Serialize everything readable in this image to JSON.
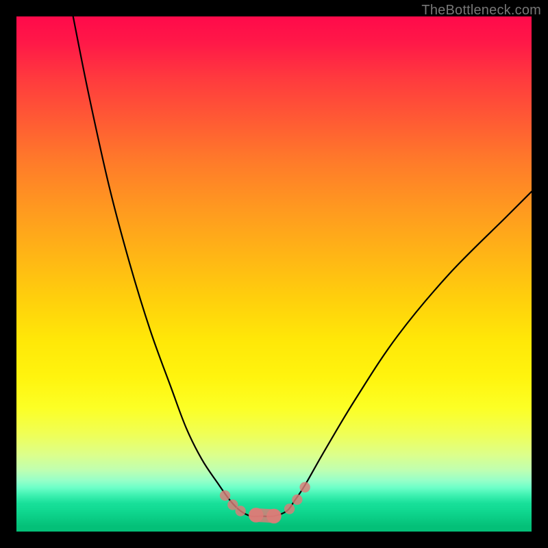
{
  "brand": {
    "watermark": "TheBottleneck.com"
  },
  "colors": {
    "background": "#000000",
    "curve": "#000000",
    "marker": "#de7b78",
    "gradient_top": "#ff0a4a",
    "gradient_bottom": "#04c078"
  },
  "chart_data": {
    "type": "line",
    "title": "",
    "xlabel": "",
    "ylabel": "",
    "xlim": [
      0,
      100
    ],
    "ylim": [
      0,
      100
    ],
    "grid": false,
    "legend": false,
    "note": "V-shaped bottleneck curve over a vertical red→orange→yellow→green gradient. No axis ticks or labels are rendered. Percent values are read off relative position inside the 752×752 plot area.",
    "series": [
      {
        "name": "bottleneck-curve",
        "x": [
          11,
          14,
          18,
          22,
          26,
          30,
          33,
          36,
          39,
          41.5,
          43.5,
          45.5,
          47.5,
          50,
          52.5,
          54,
          56,
          60,
          66,
          74,
          84,
          95,
          100
        ],
        "y": [
          100,
          85,
          67,
          52,
          39,
          28,
          20,
          14,
          9.5,
          6,
          4,
          3,
          3,
          3,
          4,
          6,
          9,
          16,
          26,
          38,
          50,
          61,
          66
        ]
      }
    ],
    "markers": {
      "name": "highlighted-range",
      "note": "Salmon lozenge/dot markers on the curve near the trough.",
      "points": [
        {
          "x": 40.5,
          "y": 7.0,
          "r": 1.7
        },
        {
          "x": 42.0,
          "y": 5.2,
          "r": 1.7
        },
        {
          "x": 43.5,
          "y": 4.0,
          "r": 1.7
        },
        {
          "x": 46.5,
          "y": 3.2,
          "r": 2.4
        },
        {
          "x": 50.0,
          "y": 3.0,
          "r": 2.4
        },
        {
          "x": 53.0,
          "y": 4.4,
          "r": 1.7
        },
        {
          "x": 54.5,
          "y": 6.2,
          "r": 1.7
        },
        {
          "x": 56.0,
          "y": 8.6,
          "r": 1.7
        }
      ]
    }
  }
}
